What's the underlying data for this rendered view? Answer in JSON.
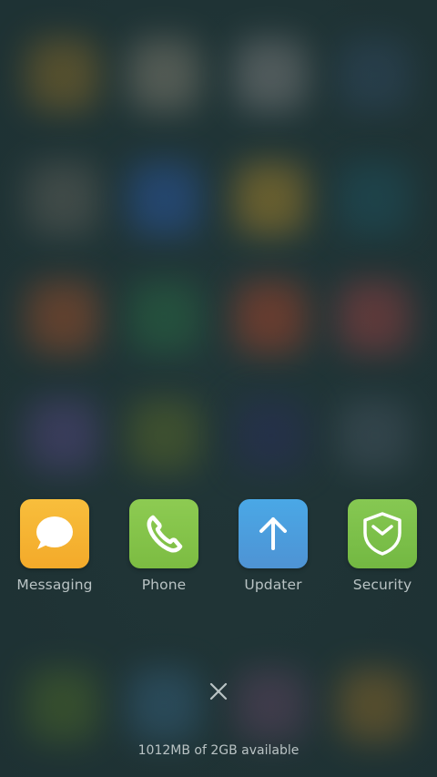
{
  "recent_apps": [
    {
      "label": "Messaging",
      "icon": "chat-bubble-icon",
      "color": "#F5B22F"
    },
    {
      "label": "Phone",
      "icon": "phone-handset-icon",
      "color": "#84C449"
    },
    {
      "label": "Updater",
      "icon": "arrow-up-icon",
      "color": "#4F9CDB"
    },
    {
      "label": "Security",
      "icon": "shield-icon",
      "color": "#7CC04A"
    }
  ],
  "close_icon": "close-icon",
  "memory": {
    "text": "1012MB of 2GB available"
  },
  "colors": {
    "background": "#213638",
    "label_text": "#B9C3C4"
  }
}
